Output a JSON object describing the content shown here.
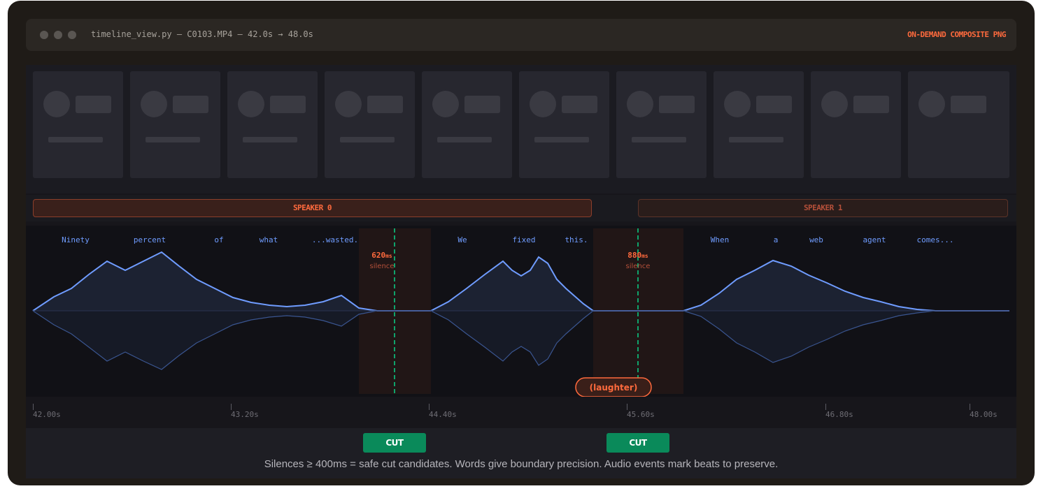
{
  "window": {
    "title": "timeline_view.py — C0103.MP4 — 42.0s → 48.0s",
    "badge": "ON-DEMAND COMPOSITE PNG"
  },
  "speakers": [
    {
      "label": "SPEAKER 0"
    },
    {
      "label": "SPEAKER 1"
    }
  ],
  "words": [
    "Ninety",
    "percent",
    "of",
    "what",
    "...wasted.",
    "We",
    "fixed",
    "this.",
    "When",
    "a",
    "web",
    "agent",
    "comes..."
  ],
  "silences": [
    {
      "value": "620",
      "unit": "ms",
      "label": "silence"
    },
    {
      "value": "880",
      "unit": "ms",
      "label": "silence"
    }
  ],
  "audio_event": {
    "label": "(laughter)"
  },
  "ruler": [
    "42.00s",
    "43.20s",
    "44.40s",
    "45.60s",
    "46.80s",
    "48.00s"
  ],
  "cut_buttons": [
    "CUT",
    "CUT"
  ],
  "caption": "Silences ≥ 400ms = safe cut candidates. Words give boundary precision. Audio events mark beats to preserve.",
  "colors": {
    "accent": "#ff6a3d",
    "word": "#6f9cff",
    "waveform": "#6f9cff",
    "cut": "#0a8a5a",
    "cut_line": "#0fa36b",
    "silence_band": "#211616"
  }
}
